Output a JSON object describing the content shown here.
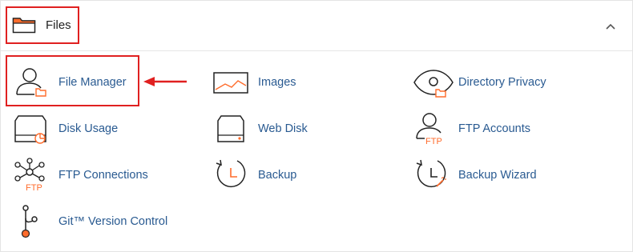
{
  "section": {
    "title": "Files",
    "icon": "folder-icon",
    "collapse_icon": "chevron-up-icon"
  },
  "items": [
    {
      "label": "File Manager",
      "icon": "file-manager-icon"
    },
    {
      "label": "Images",
      "icon": "images-icon"
    },
    {
      "label": "Directory Privacy",
      "icon": "directory-privacy-icon"
    },
    {
      "label": "Disk Usage",
      "icon": "disk-usage-icon"
    },
    {
      "label": "Web Disk",
      "icon": "web-disk-icon"
    },
    {
      "label": "FTP Accounts",
      "icon": "ftp-accounts-icon"
    },
    {
      "label": "FTP Connections",
      "icon": "ftp-connections-icon"
    },
    {
      "label": "Backup",
      "icon": "backup-icon"
    },
    {
      "label": "Backup Wizard",
      "icon": "backup-wizard-icon"
    },
    {
      "label": "Git™ Version Control",
      "icon": "git-icon"
    }
  ],
  "icon_texts": {
    "ftp": "FTP"
  },
  "colors": {
    "link": "#295a91",
    "accent": "#ff6c2c",
    "highlight": "#e02020",
    "icon_stroke": "#222222"
  }
}
